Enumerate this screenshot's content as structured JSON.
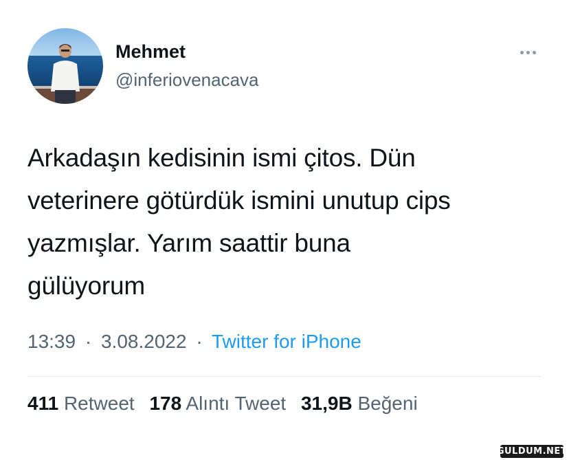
{
  "user": {
    "display_name": "Mehmet",
    "handle": "@inferiovenacava"
  },
  "more_icon": "ellipsis-icon",
  "tweet": {
    "lines": [
      "Arkadaşın kedisinin ismi çitos. Dün",
      "veterinere götürdük ismini unutup cips",
      "yazmışlar. Yarım saattir buna",
      "gülüyorum"
    ]
  },
  "meta": {
    "time": "13:39",
    "separator": "·",
    "date": "3.08.2022",
    "source": "Twitter for iPhone"
  },
  "stats": {
    "retweets": {
      "count": "411",
      "label": "Retweet"
    },
    "quotes": {
      "count": "178",
      "label": "Alıntı Tweet"
    },
    "likes": {
      "count": "31,9B",
      "label": "Beğeni"
    }
  },
  "watermark": "GULDUM.NET",
  "colors": {
    "text": "#0f1419",
    "secondary": "#536471",
    "link": "#1d9bf0",
    "divider": "#e6e9eb"
  }
}
